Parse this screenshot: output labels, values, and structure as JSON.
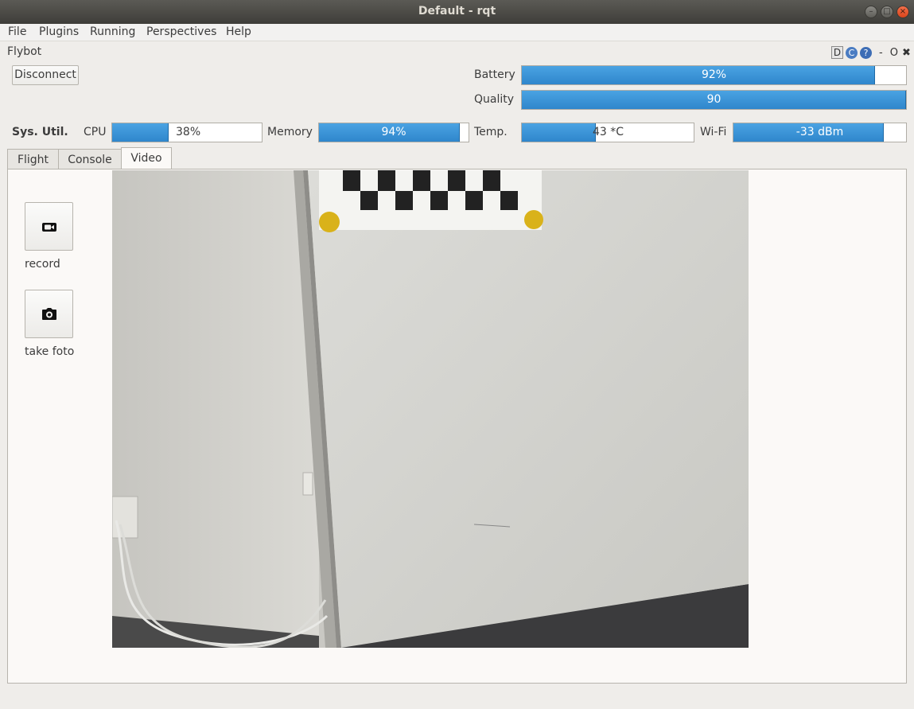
{
  "window": {
    "title": "Default - rqt",
    "buttons": {
      "minimize": "–",
      "maximize": "□",
      "close": "×"
    }
  },
  "menubar": {
    "items": [
      {
        "label": "File"
      },
      {
        "label": "Plugins"
      },
      {
        "label": "Running"
      },
      {
        "label": "Perspectives"
      },
      {
        "label": "Help"
      }
    ]
  },
  "plugin": {
    "title": "Flybot",
    "controls": {
      "d": "D",
      "reload": "C",
      "help": "?",
      "minimize": "-",
      "float": "O",
      "close": "✖"
    }
  },
  "connection": {
    "disconnect_label": "Disconnect"
  },
  "status": {
    "battery": {
      "label": "Battery",
      "text": "92%",
      "fraction": 0.92
    },
    "quality": {
      "label": "Quality",
      "text": "90",
      "fraction": 1.0
    }
  },
  "sysutil": {
    "heading": "Sys. Util.",
    "cpu": {
      "label": "CPU",
      "text": "38%",
      "fraction": 0.38
    },
    "memory": {
      "label": "Memory",
      "text": "94%",
      "fraction": 0.94
    },
    "temp": {
      "label": "Temp.",
      "text": "43 *C",
      "fraction": 0.43
    },
    "wifi": {
      "label": "Wi-Fi",
      "text": "-33 dBm",
      "fraction": 0.87
    }
  },
  "tabs": [
    {
      "label": "Flight",
      "active": false
    },
    {
      "label": "Console",
      "active": false
    },
    {
      "label": "Video",
      "active": true
    }
  ],
  "video_panel": {
    "record_label": "record",
    "photo_label": "take foto"
  },
  "colors": {
    "progress_fill": "#2f86cc",
    "window_bg": "#efedea",
    "marker_yellow": "#d9b21a"
  }
}
